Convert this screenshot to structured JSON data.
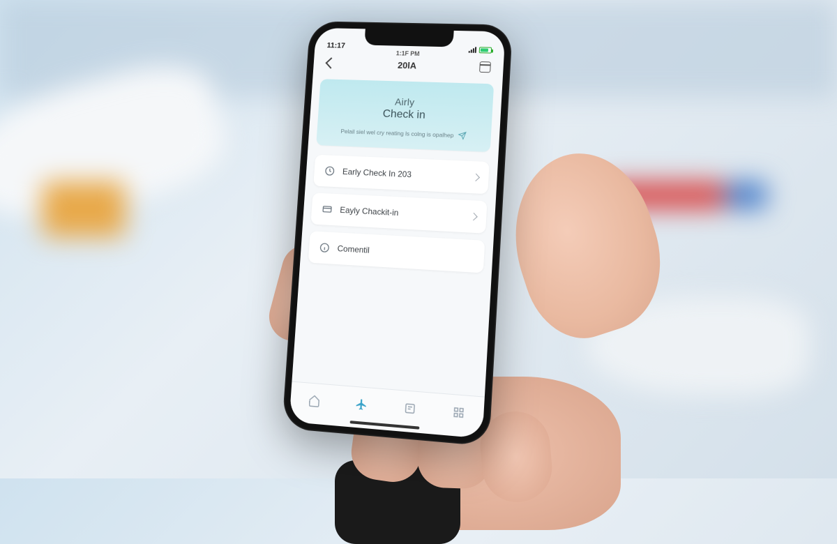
{
  "status": {
    "time": "11:17",
    "meridiem": "1:1F PM"
  },
  "nav": {
    "title": "20lA"
  },
  "hero": {
    "line1": "Airly",
    "line2": "Check in",
    "subtitle": "Pelail siel wel cry reating ls colng is opalhep"
  },
  "list": {
    "items": [
      {
        "label": "Early Check In 203"
      },
      {
        "label": "Eayly Chackit-in"
      },
      {
        "label": "Comentil"
      }
    ]
  },
  "tabs": {
    "items": [
      {
        "label": ""
      },
      {
        "label": ""
      },
      {
        "label": ""
      },
      {
        "label": ""
      }
    ],
    "active_index": 1
  }
}
